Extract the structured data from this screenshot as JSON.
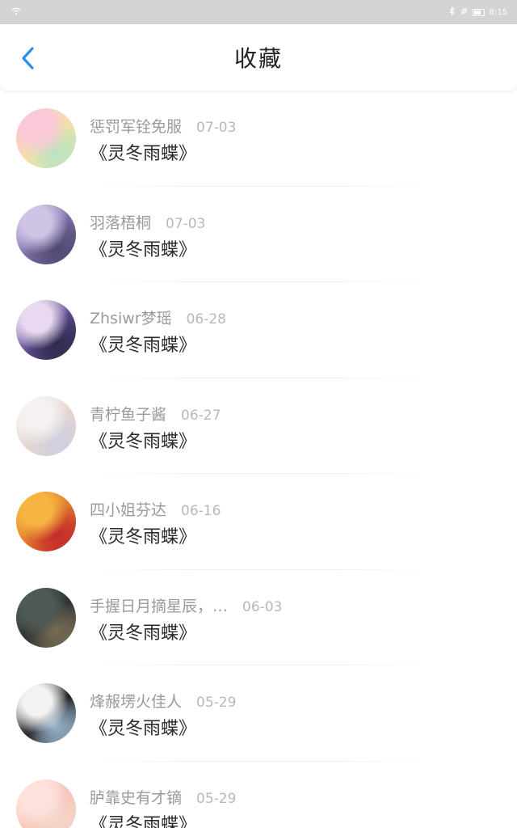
{
  "status": {
    "time": "8:15"
  },
  "header": {
    "title": "收藏"
  },
  "items": [
    {
      "name": "惩罚军铨免服",
      "date": "07-03",
      "work": "《灵冬雨蝶》",
      "avatar": [
        "#f9c9d8",
        "#f7e1a3",
        "#b9e3c2"
      ]
    },
    {
      "name": "羽落梧桐",
      "date": "07-03",
      "work": "《灵冬雨蝶》",
      "avatar": [
        "#cfc3e6",
        "#7b6aa6",
        "#4f4a6e"
      ]
    },
    {
      "name": "Zhsiwr梦瑶",
      "date": "06-28",
      "work": "《灵冬雨蝶》",
      "avatar": [
        "#e9d9f0",
        "#5b4a8f",
        "#2e2a4a"
      ]
    },
    {
      "name": "青柠鱼子酱",
      "date": "06-27",
      "work": "《灵冬雨蝶》",
      "avatar": [
        "#f5f1f0",
        "#e8d5d0",
        "#cfcfe0"
      ]
    },
    {
      "name": "四小姐芬达",
      "date": "06-16",
      "work": "《灵冬雨蝶》",
      "avatar": [
        "#f6b542",
        "#e07a2b",
        "#c2272d"
      ]
    },
    {
      "name": "手握日月摘星辰，…",
      "date": "06-03",
      "work": "《灵冬雨蝶》",
      "avatar": [
        "#4f5a56",
        "#2b3130",
        "#7a6d55"
      ]
    },
    {
      "name": "烽赧塄火佳人",
      "date": "05-29",
      "work": "《灵冬雨蝶》",
      "avatar": [
        "#f2f2f2",
        "#1b1b1b",
        "#9ab7cf"
      ]
    },
    {
      "name": "胪靠史有才镝",
      "date": "05-29",
      "work": "《灵冬雨蝶》",
      "avatar": [
        "#fde2db",
        "#f6c3b8",
        "#f3d6c9"
      ]
    }
  ],
  "colors": {
    "accent": "#2b8df0",
    "statusbar": "#d4d4d4"
  }
}
